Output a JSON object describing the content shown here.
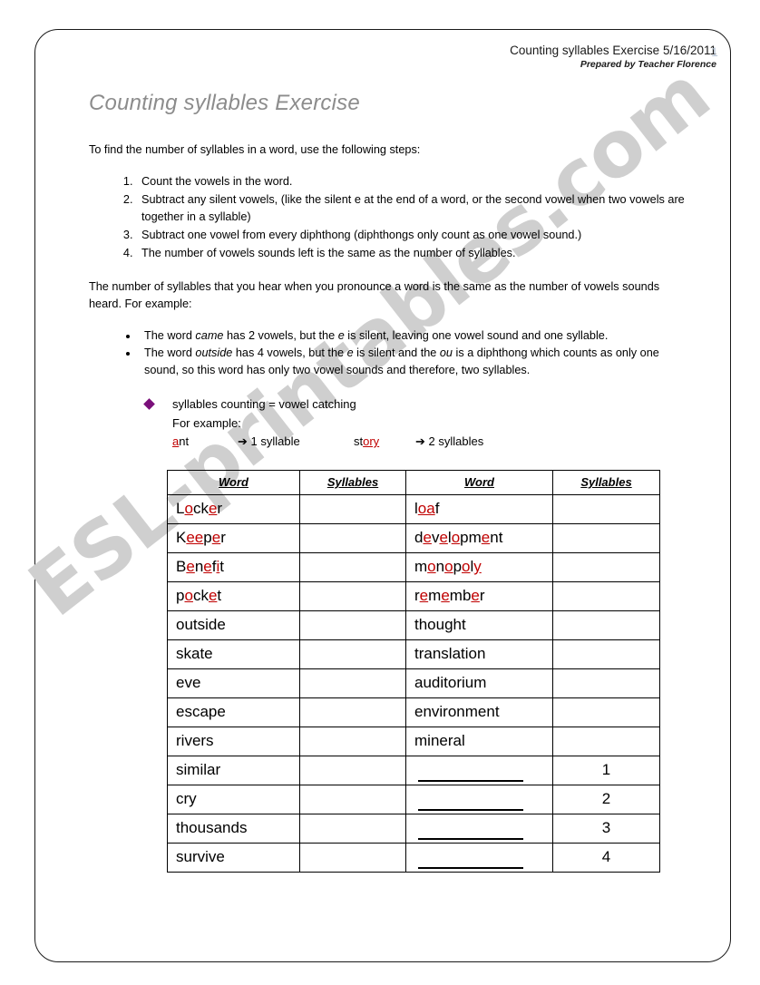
{
  "header": {
    "title_date": "Counting syllables Exercise  5/16/2011",
    "prepared_by": "Prepared by Teacher Florence",
    "page_number": "1"
  },
  "watermark": {
    "text": "ESL-printables.com",
    "color": "#cfcfcf"
  },
  "document": {
    "title": "Counting syllables Exercise",
    "intro": "To find the number of syllables in a word, use the following steps:",
    "steps": [
      "Count the vowels in the word.",
      "Subtract any silent vowels, (like the silent e at the end of a word, or the second vowel when two vowels are together in a syllable)",
      "Subtract one vowel from every diphthong (diphthongs only count as one vowel sound.)",
      "The number of vowels sounds left is the same as the number of syllables."
    ],
    "example_intro": "The number of syllables that you hear when you pronounce a word is the same as the number of vowels sounds heard. For example:",
    "bullets": [
      {
        "pre": "The word ",
        "italic1": "came",
        "mid": " has 2 vowels, but the ",
        "italic2": "e",
        "post": " is silent, leaving one vowel sound and one syllable."
      },
      {
        "pre": "The word ",
        "italic1": "outside",
        "mid": " has 4 vowels, but the ",
        "italic2": "e",
        "mid2": " is silent and the ",
        "italic3": "ou",
        "post": " is a diphthong which counts as only one sound, so this word has only two vowel sounds and therefore, two syllables."
      }
    ],
    "diamond": {
      "bullet_color": "#7a0f7a",
      "line1": "syllables counting = vowel catching",
      "line2": "For example:",
      "example_left_word_pre": "",
      "example_left_word_vowel": "a",
      "example_left_word_post": "nt",
      "example_left_result": "➔ 1 syllable",
      "example_right_word_pre": "st",
      "example_right_word_vowel": "ory",
      "example_right_word_post": "",
      "example_right_result": "➔ 2 syllables"
    }
  },
  "table": {
    "headers": [
      "Word",
      "Syllables",
      "Word",
      "Syllables"
    ],
    "rows": [
      {
        "left": {
          "parts": [
            {
              "t": "L",
              "v": false
            },
            {
              "t": "o",
              "v": true
            },
            {
              "t": "ck",
              "v": false
            },
            {
              "t": "e",
              "v": true
            },
            {
              "t": "r",
              "v": false
            }
          ],
          "plain": "Locker"
        },
        "left_count": "",
        "right": {
          "parts": [
            {
              "t": "l",
              "v": false
            },
            {
              "t": "oa",
              "v": true
            },
            {
              "t": "f",
              "v": false
            }
          ],
          "plain": "loaf"
        },
        "right_count": ""
      },
      {
        "left": {
          "parts": [
            {
              "t": "K",
              "v": false
            },
            {
              "t": "ee",
              "v": true
            },
            {
              "t": "p",
              "v": false
            },
            {
              "t": "e",
              "v": true
            },
            {
              "t": "r",
              "v": false
            }
          ],
          "plain": "Keeper"
        },
        "left_count": "",
        "right": {
          "parts": [
            {
              "t": "d",
              "v": false
            },
            {
              "t": "e",
              "v": true
            },
            {
              "t": "v",
              "v": false
            },
            {
              "t": "e",
              "v": true
            },
            {
              "t": "l",
              "v": false
            },
            {
              "t": "o",
              "v": true
            },
            {
              "t": "pm",
              "v": false
            },
            {
              "t": "e",
              "v": true
            },
            {
              "t": "nt",
              "v": false
            }
          ],
          "plain": "development"
        },
        "right_count": ""
      },
      {
        "left": {
          "parts": [
            {
              "t": "B",
              "v": false
            },
            {
              "t": "e",
              "v": true
            },
            {
              "t": "n",
              "v": false
            },
            {
              "t": "e",
              "v": true
            },
            {
              "t": "f",
              "v": false
            },
            {
              "t": "i",
              "v": true
            },
            {
              "t": "t",
              "v": false
            }
          ],
          "plain": "Benefit"
        },
        "left_count": "",
        "right": {
          "parts": [
            {
              "t": "m",
              "v": false
            },
            {
              "t": "o",
              "v": true
            },
            {
              "t": "n",
              "v": false
            },
            {
              "t": "o",
              "v": true
            },
            {
              "t": "p",
              "v": false
            },
            {
              "t": "o",
              "v": true
            },
            {
              "t": "l",
              "v": false
            },
            {
              "t": "y",
              "v": true
            }
          ],
          "plain": "monopoly"
        },
        "right_count": ""
      },
      {
        "left": {
          "parts": [
            {
              "t": "p",
              "v": false
            },
            {
              "t": "o",
              "v": true
            },
            {
              "t": "ck",
              "v": false
            },
            {
              "t": "e",
              "v": true
            },
            {
              "t": "t",
              "v": false
            }
          ],
          "plain": "pocket"
        },
        "left_count": "",
        "right": {
          "parts": [
            {
              "t": "r",
              "v": false
            },
            {
              "t": "e",
              "v": true
            },
            {
              "t": "m",
              "v": false
            },
            {
              "t": "e",
              "v": true
            },
            {
              "t": "mb",
              "v": false
            },
            {
              "t": "e",
              "v": true
            },
            {
              "t": "r",
              "v": false
            }
          ],
          "plain": "remember"
        },
        "right_count": ""
      },
      {
        "left": {
          "parts": [
            {
              "t": "outside",
              "v": false
            }
          ],
          "plain": "outside"
        },
        "left_count": "",
        "right": {
          "parts": [
            {
              "t": "thought",
              "v": false
            }
          ],
          "plain": "thought"
        },
        "right_count": ""
      },
      {
        "left": {
          "parts": [
            {
              "t": "skate",
              "v": false
            }
          ],
          "plain": "skate"
        },
        "left_count": "",
        "right": {
          "parts": [
            {
              "t": "translation",
              "v": false
            }
          ],
          "plain": "translation"
        },
        "right_count": ""
      },
      {
        "left": {
          "parts": [
            {
              "t": "eve",
              "v": false
            }
          ],
          "plain": "eve"
        },
        "left_count": "",
        "right": {
          "parts": [
            {
              "t": "auditorium",
              "v": false
            }
          ],
          "plain": "auditorium"
        },
        "right_count": ""
      },
      {
        "left": {
          "parts": [
            {
              "t": "escape",
              "v": false
            }
          ],
          "plain": "escape"
        },
        "left_count": "",
        "right": {
          "parts": [
            {
              "t": "environment",
              "v": false
            }
          ],
          "plain": "environment"
        },
        "right_count": ""
      },
      {
        "left": {
          "parts": [
            {
              "t": "rivers",
              "v": false
            }
          ],
          "plain": "rivers"
        },
        "left_count": "",
        "right": {
          "parts": [
            {
              "t": "mineral",
              "v": false
            }
          ],
          "plain": "mineral"
        },
        "right_count": ""
      },
      {
        "left": {
          "parts": [
            {
              "t": "similar",
              "v": false
            }
          ],
          "plain": "similar"
        },
        "left_count": "",
        "right": {
          "parts": [],
          "plain": "",
          "blank": true
        },
        "right_count": "1"
      },
      {
        "left": {
          "parts": [
            {
              "t": "cry",
              "v": false
            }
          ],
          "plain": "cry"
        },
        "left_count": "",
        "right": {
          "parts": [],
          "plain": "",
          "blank": true
        },
        "right_count": "2"
      },
      {
        "left": {
          "parts": [
            {
              "t": "thousands",
              "v": false
            }
          ],
          "plain": "thousands"
        },
        "left_count": "",
        "right": {
          "parts": [],
          "plain": "",
          "blank": true
        },
        "right_count": "3"
      },
      {
        "left": {
          "parts": [
            {
              "t": "survive",
              "v": false
            }
          ],
          "plain": "survive"
        },
        "left_count": "",
        "right": {
          "parts": [],
          "plain": "",
          "blank": true
        },
        "right_count": "4"
      }
    ]
  }
}
